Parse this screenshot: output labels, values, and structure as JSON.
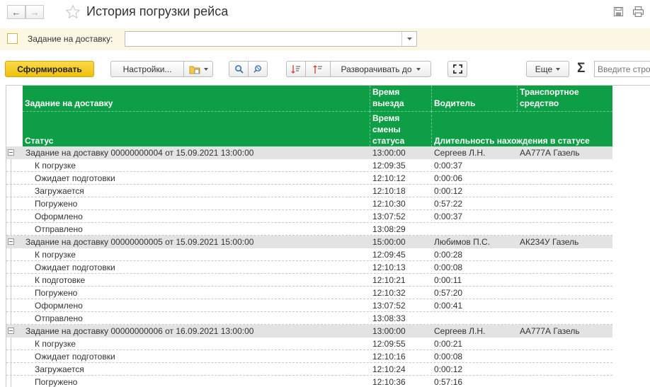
{
  "window": {
    "title": "История погрузки рейса",
    "back_icon": "←",
    "forward_icon": "→"
  },
  "filter": {
    "checkbox_label": "Задание на доставку:",
    "value": ""
  },
  "toolbar": {
    "generate_label": "Сформировать",
    "settings_label": "Настройки...",
    "expand_to_label": "Разворачивать до",
    "more_label": "Еще",
    "sigma": "Σ",
    "search_placeholder": "Введите строку поиска"
  },
  "table": {
    "headers": {
      "task": "Задание на доставку",
      "departure": [
        "Время",
        "выезда"
      ],
      "driver": "Водитель",
      "vehicle": [
        "Транспортное",
        "средство"
      ],
      "status": "Статус",
      "status_change": [
        "Время",
        "смены",
        "статуса"
      ],
      "duration": "Длительность нахождения в статусе"
    },
    "rows": [
      {
        "type": "group",
        "name": "Задание на доставку 00000000004 от 15.09.2021 13:00:00",
        "time": "13:00:00",
        "driver": "Сергеев Л.Н.",
        "vehicle": "АА777А Газель"
      },
      {
        "type": "detail",
        "name": "К погрузке",
        "time": "12:09:35",
        "duration": "0:00:37"
      },
      {
        "type": "detail",
        "name": "Ожидает подготовки",
        "time": "12:10:12",
        "duration": "0:00:06"
      },
      {
        "type": "detail",
        "name": "Загружается",
        "time": "12:10:18",
        "duration": "0:00:12"
      },
      {
        "type": "detail",
        "name": "Погружено",
        "time": "12:10:30",
        "duration": "0:57:22"
      },
      {
        "type": "detail",
        "name": "Оформлено",
        "time": "13:07:52",
        "duration": "0:00:37"
      },
      {
        "type": "detail",
        "name": "Отправлено",
        "time": "13:08:29",
        "duration": ""
      },
      {
        "type": "group",
        "name": "Задание на доставку 00000000005 от 15.09.2021 15:00:00",
        "time": "15:00:00",
        "driver": "Любимов П.С.",
        "vehicle": "АК234У Газель"
      },
      {
        "type": "detail",
        "name": "К погрузке",
        "time": "12:09:45",
        "duration": "0:00:28"
      },
      {
        "type": "detail",
        "name": "Ожидает подготовки",
        "time": "12:10:13",
        "duration": "0:00:08"
      },
      {
        "type": "detail",
        "name": "К подготовке",
        "time": "12:10:21",
        "duration": "0:00:11"
      },
      {
        "type": "detail",
        "name": "Погружено",
        "time": "12:10:32",
        "duration": "0:57:20"
      },
      {
        "type": "detail",
        "name": "Оформлено",
        "time": "13:07:52",
        "duration": "0:00:41"
      },
      {
        "type": "detail",
        "name": "Отправлено",
        "time": "13:08:33",
        "duration": ""
      },
      {
        "type": "group",
        "name": "Задание на доставку 00000000006 от 16.09.2021 13:00:00",
        "time": "13:00:00",
        "driver": "Сергеев Л.Н.",
        "vehicle": "АА777А Газель"
      },
      {
        "type": "detail",
        "name": "К погрузке",
        "time": "12:09:55",
        "duration": "0:00:21"
      },
      {
        "type": "detail",
        "name": "Ожидает подготовки",
        "time": "12:10:16",
        "duration": "0:00:08"
      },
      {
        "type": "detail",
        "name": "Загружается",
        "time": "12:10:24",
        "duration": "0:00:12"
      },
      {
        "type": "detail",
        "name": "Погружено",
        "time": "12:10:36",
        "duration": "0:57:16"
      }
    ]
  },
  "colors": {
    "header_green": "#0d9e46",
    "primary_button": "#f6c915",
    "filter_bg": "#fdf8e4",
    "group_row": "#e3e3e3"
  }
}
